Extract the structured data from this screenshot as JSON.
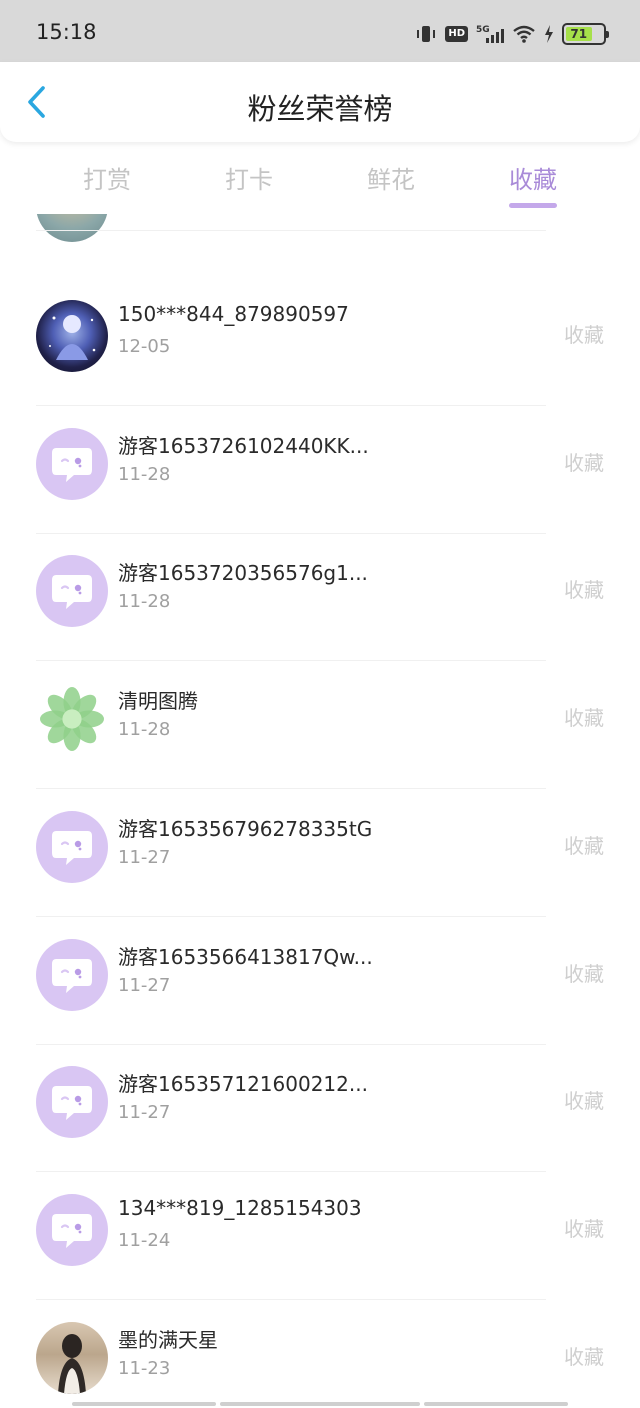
{
  "status_bar": {
    "time": "15:18",
    "network": "5G",
    "hd": "HD",
    "battery_level": "71",
    "battery_fill_fraction": 0.71
  },
  "header": {
    "title": "粉丝荣誉榜",
    "back_icon": "chevron-left-icon",
    "accent_color": "#2aa7e0"
  },
  "tabs": [
    {
      "label": "打赏",
      "active": false
    },
    {
      "label": "打卡",
      "active": false
    },
    {
      "label": "鲜花",
      "active": false
    },
    {
      "label": "收藏",
      "active": true
    }
  ],
  "colors": {
    "active_tab": "#a98bd8",
    "default_avatar": "#d9c6f3",
    "action_text": "#cfcfcf"
  },
  "list": [
    {
      "name": "150***844_879890597",
      "date": "12-05",
      "action": "收藏",
      "avatar": "anime"
    },
    {
      "name": "游客1653726102440KK...",
      "date": "11-28",
      "action": "收藏",
      "avatar": "default"
    },
    {
      "name": "游客1653720356576g1...",
      "date": "11-28",
      "action": "收藏",
      "avatar": "default"
    },
    {
      "name": "清明图腾",
      "date": "11-28",
      "action": "收藏",
      "avatar": "flower"
    },
    {
      "name": "游客165356796278335tG",
      "date": "11-27",
      "action": "收藏",
      "avatar": "default"
    },
    {
      "name": "游客1653566413817Qw...",
      "date": "11-27",
      "action": "收藏",
      "avatar": "default"
    },
    {
      "name": "游客165357121600212...",
      "date": "11-27",
      "action": "收藏",
      "avatar": "default"
    },
    {
      "name": "134***819_1285154303",
      "date": "11-24",
      "action": "收藏",
      "avatar": "default"
    },
    {
      "name": "墨的满天星",
      "date": "11-23",
      "action": "收藏",
      "avatar": "photo"
    }
  ]
}
